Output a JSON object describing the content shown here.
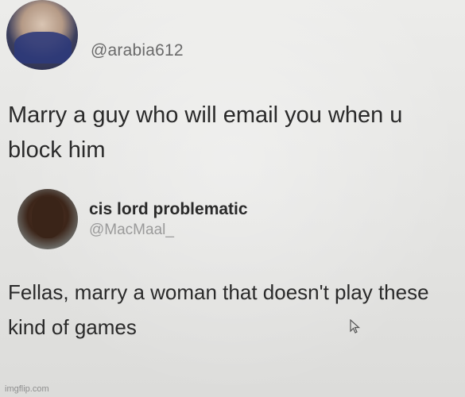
{
  "tweet_1": {
    "handle": "@arabia612",
    "text": "Marry a guy who will email you when u block him"
  },
  "tweet_2": {
    "display_name": "cis lord problematic",
    "handle": "@MacMaal_",
    "text": "Fellas, marry a woman that doesn't play these kind of games"
  },
  "cursor_icon": "mouse-pointer-icon",
  "watermark": "imgflip.com"
}
